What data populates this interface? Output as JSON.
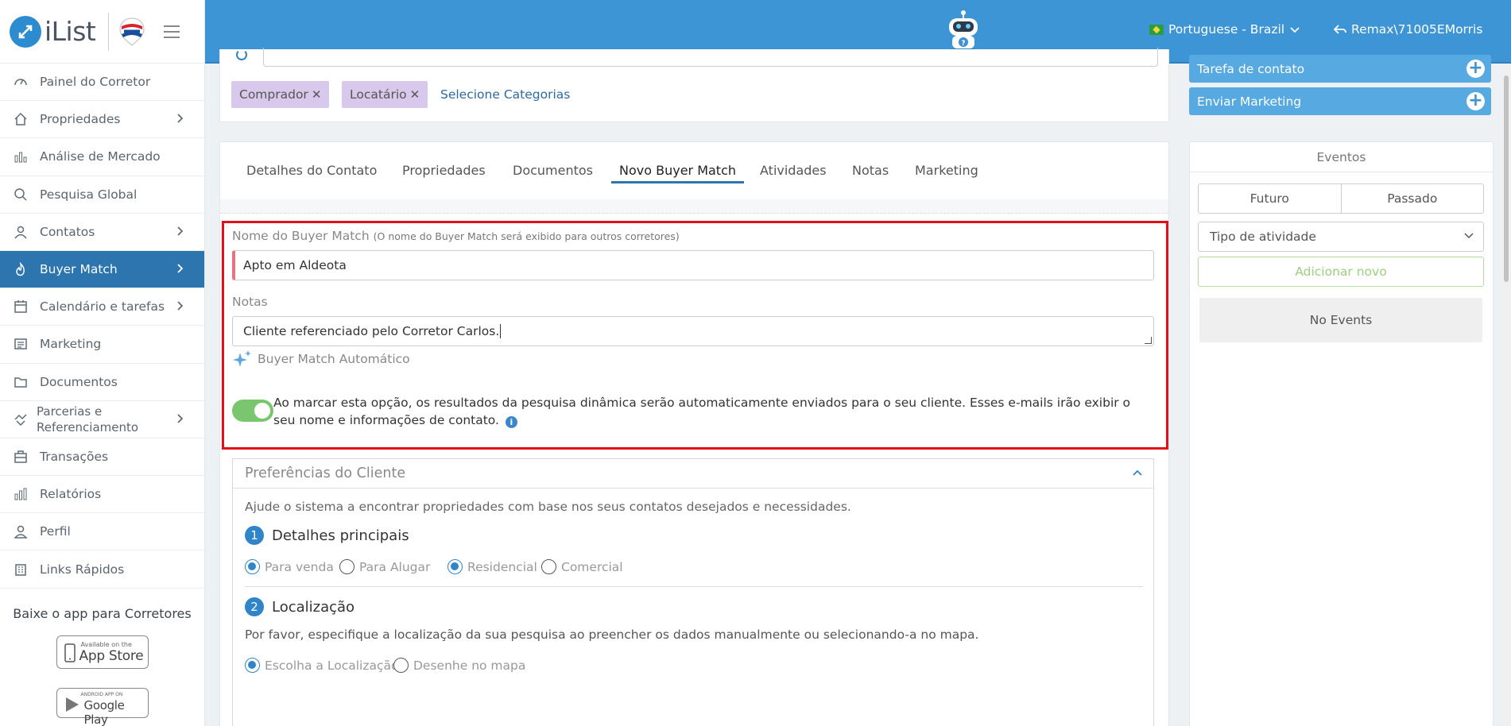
{
  "brand": {
    "logo_text": "iList"
  },
  "sidebar": {
    "items": [
      {
        "label": "Painel do Corretor",
        "icon": "dashboard-icon",
        "chevron": false,
        "active": false
      },
      {
        "label": "Propriedades",
        "icon": "home-icon",
        "chevron": true,
        "active": false
      },
      {
        "label": "Análise de Mercado",
        "icon": "bar-chart-icon",
        "chevron": false,
        "active": false
      },
      {
        "label": "Pesquisa Global",
        "icon": "search-icon",
        "chevron": false,
        "active": false
      },
      {
        "label": "Contatos",
        "icon": "contacts-icon",
        "chevron": true,
        "active": false
      },
      {
        "label": "Buyer Match",
        "icon": "flame-icon",
        "chevron": true,
        "active": true
      },
      {
        "label": "Calendário e tarefas",
        "icon": "calendar-icon",
        "chevron": true,
        "active": false
      },
      {
        "label": "Marketing",
        "icon": "newspaper-icon",
        "chevron": false,
        "active": false
      },
      {
        "label": "Documentos",
        "icon": "folder-icon",
        "chevron": false,
        "active": false
      },
      {
        "label": "Parcerias e Referenciamento",
        "icon": "handshake-icon",
        "chevron": true,
        "active": false
      },
      {
        "label": "Transações",
        "icon": "briefcase-icon",
        "chevron": false,
        "active": false
      },
      {
        "label": "Relatórios",
        "icon": "reports-icon",
        "chevron": false,
        "active": false
      },
      {
        "label": "Perfil",
        "icon": "user-icon",
        "chevron": false,
        "active": false
      },
      {
        "label": "Links Rápidos",
        "icon": "building-icon",
        "chevron": false,
        "active": false
      }
    ],
    "app_title": "Baixe o app para Corretores",
    "app_store": {
      "small": "Available on the",
      "big": "App Store"
    },
    "google_play": {
      "small": "ANDROID APP ON",
      "big": "Google Play"
    }
  },
  "header": {
    "language": "Portuguese - Brazil",
    "user": "Remax\\71005EMorris"
  },
  "categories": {
    "chips": [
      "Comprador",
      "Locatário"
    ],
    "select_label": "Selecione Categorias"
  },
  "tabs": [
    "Detalhes do Contato",
    "Propriedades",
    "Documentos",
    "Novo Buyer Match",
    "Atividades",
    "Notas",
    "Marketing"
  ],
  "active_tab": "Novo Buyer Match",
  "form": {
    "name_label": "Nome do Buyer Match",
    "name_hint": "(O nome do Buyer Match será exibido para outros corretores)",
    "name_value": "Apto em Aldeota",
    "notes_label": "Notas",
    "notes_value": "Cliente referenciado pelo Corretor Carlos.",
    "auto_label": "Buyer Match Automático",
    "toggle_on": true,
    "toggle_text": "Ao marcar esta opção, os resultados da pesquisa dinâmica serão automaticamente enviados para o seu cliente. Esses e-mails irão exibir o seu nome e informações de contato."
  },
  "preferences": {
    "title": "Preferências do Cliente",
    "description": "Ajude o sistema a encontrar propriedades com base nos seus contatos desejados e necessidades.",
    "step1": {
      "num": "1",
      "title": "Detalhes principais"
    },
    "step1_options": [
      {
        "label": "Para venda",
        "selected": true
      },
      {
        "label": "Para Alugar",
        "selected": false
      },
      {
        "label": "Residencial",
        "selected": true
      },
      {
        "label": "Comercial",
        "selected": false
      }
    ],
    "step2": {
      "num": "2",
      "title": "Localização"
    },
    "step2_desc": "Por favor, especifique a localização da sua pesquisa ao preencher os dados manualmente ou selecionando-a no mapa.",
    "step2_options": [
      {
        "label": "Escolha a Localização",
        "selected": true
      },
      {
        "label": "Desenhe no mapa",
        "selected": false
      }
    ]
  },
  "right": {
    "contact_task": "Tarefa de contato",
    "send_marketing": "Enviar Marketing",
    "events_title": "Eventos",
    "future": "Futuro",
    "past": "Passado",
    "activity_type": "Tipo de atividade",
    "add_new": "Adicionar novo",
    "no_events": "No Events"
  },
  "colors": {
    "header_blue": "#3e95d6",
    "active_nav": "#2c75ae",
    "highlight_red": "#e2101a",
    "toggle_green": "#7ac66f",
    "chip_purple": "#d8c8ec"
  }
}
